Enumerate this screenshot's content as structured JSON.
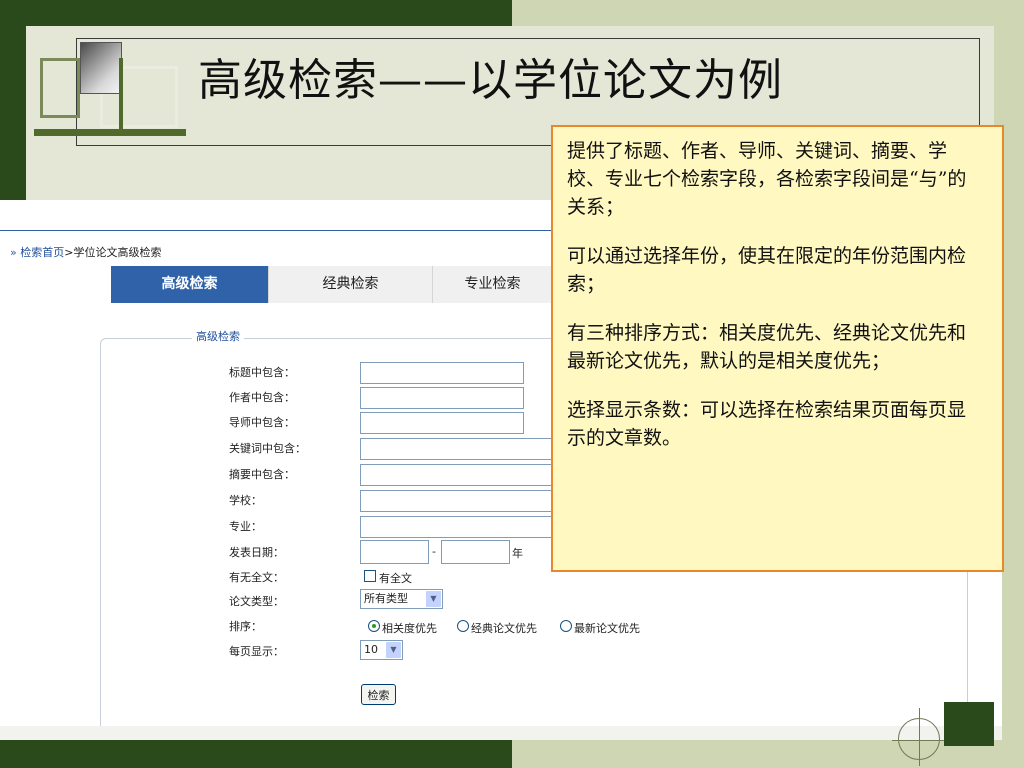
{
  "slide": {
    "title": "高级检索——以学位论文为例"
  },
  "breadcrumb": {
    "prefix": "»",
    "home": "检索首页",
    "separator": ">",
    "current": "学位论文高级检索"
  },
  "tabs": [
    {
      "label": "高级检索",
      "active": true
    },
    {
      "label": "经典检索",
      "active": false
    },
    {
      "label": "专业检索",
      "active": false
    }
  ],
  "form": {
    "legend": "高级检索",
    "fields": {
      "title": {
        "label": "标题中包含：",
        "value": ""
      },
      "author": {
        "label": "作者中包含：",
        "value": ""
      },
      "advisor": {
        "label": "导师中包含：",
        "value": ""
      },
      "keyword": {
        "label": "关键词中包含：",
        "value": ""
      },
      "abstract": {
        "label": "摘要中包含：",
        "value": ""
      },
      "school": {
        "label": "学校：",
        "value": ""
      },
      "major": {
        "label": "专业：",
        "value": ""
      }
    },
    "date": {
      "label": "发表日期：",
      "from": "",
      "dash": "-",
      "to": "",
      "unit": "年"
    },
    "fulltext": {
      "label": "有无全文：",
      "checkbox_label": "有全文",
      "checked": false
    },
    "paper_type": {
      "label": "论文类型：",
      "selected": "所有类型"
    },
    "sort": {
      "label": "排序：",
      "options": [
        {
          "label": "相关度优先",
          "checked": true
        },
        {
          "label": "经典论文优先",
          "checked": false
        },
        {
          "label": "最新论文优先",
          "checked": false
        }
      ]
    },
    "per_page": {
      "label": "每页显示：",
      "selected": "10"
    },
    "submit_label": "检索"
  },
  "callout": {
    "paragraphs": [
      "提供了标题、作者、导师、关键词、摘要、学校、专业七个检索字段，各检索字段间是“与”的关系；",
      "可以通过选择年份，使其在限定的年份范围内检索；",
      "有三种排序方式：相关度优先、经典论文优先和最新论文优先，默认的是相关度优先；",
      "选择显示条数：可以选择在检索结果页面每页显示的文章数。"
    ]
  },
  "colors": {
    "dark_green": "#2b4a1b",
    "tab_active": "#2f62a8",
    "callout_bg": "#fff8c0",
    "callout_border": "#e8882a"
  }
}
